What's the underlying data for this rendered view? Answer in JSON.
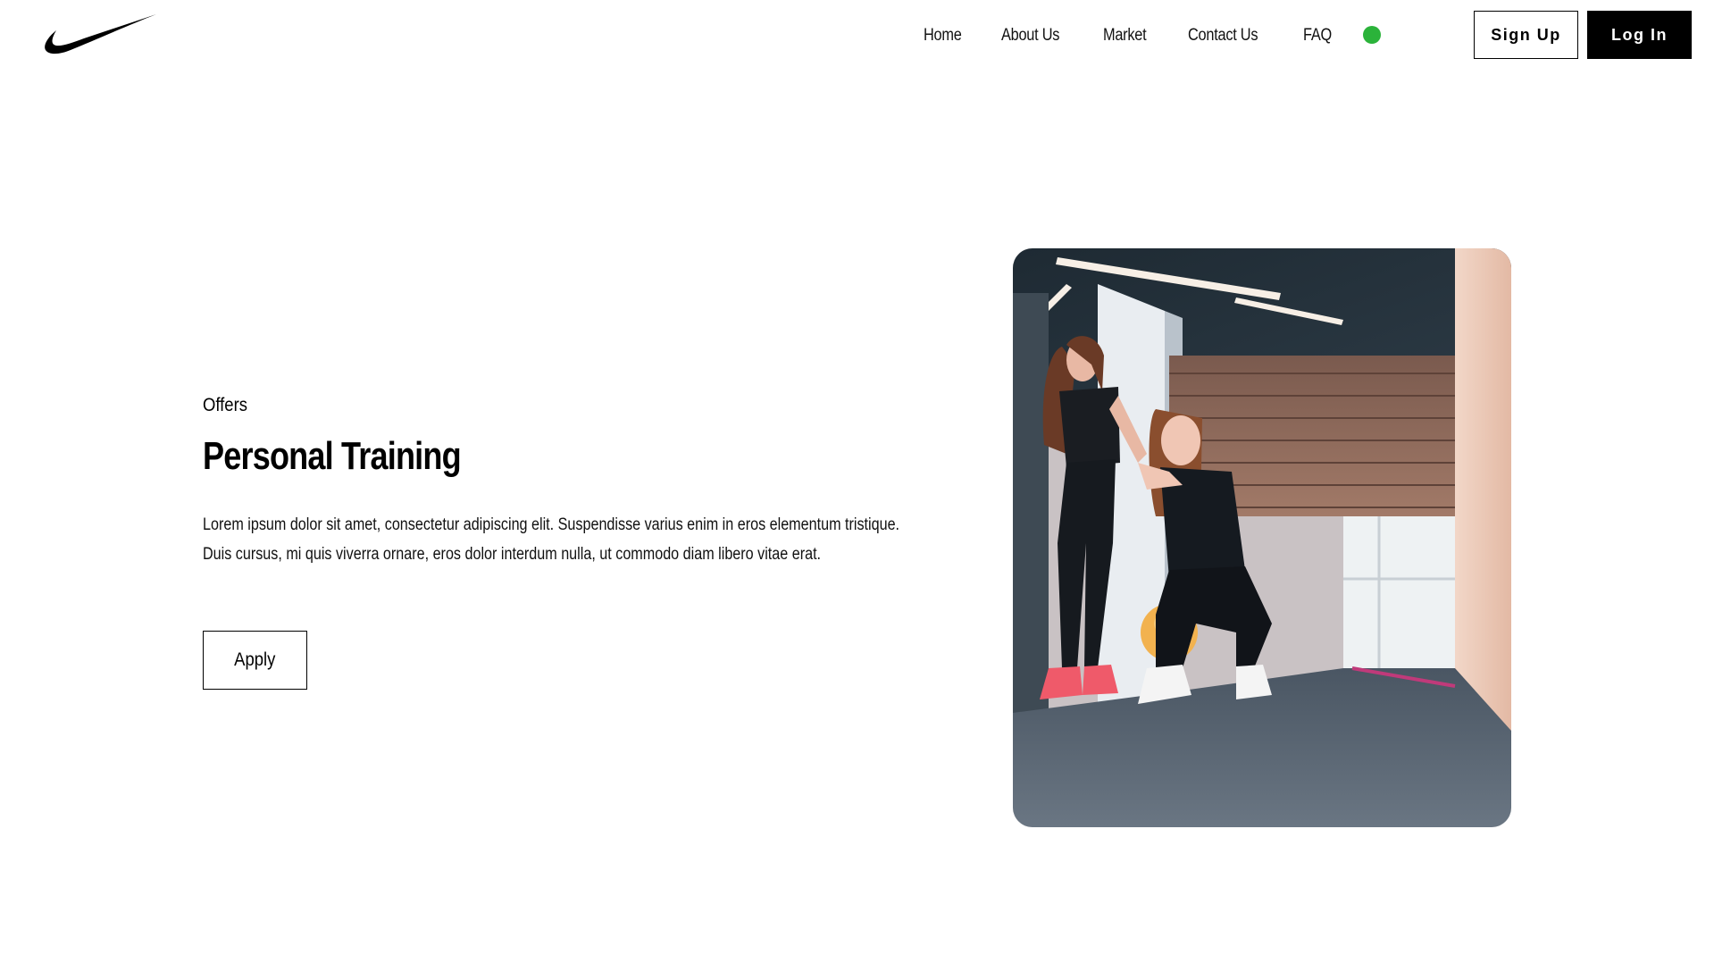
{
  "header": {
    "logo_icon": "swoosh-logo-icon",
    "nav": [
      {
        "label": "Home"
      },
      {
        "label": "About Us"
      },
      {
        "label": "Market"
      },
      {
        "label": "Contact Us"
      },
      {
        "label": "FAQ"
      }
    ],
    "status_dot_color": "#2bb33a",
    "signup_label": "Sign Up",
    "login_label": "Log In"
  },
  "hero": {
    "eyebrow": "Offers",
    "title": "Personal Training",
    "description": "Lorem ipsum dolor sit amet, consectetur adipiscing elit. Suspendisse varius enim in eros elementum tristique. Duis cursus, mi quis viverra ornare, eros dolor interdum nulla, ut commodo diam libero vitae erat.",
    "apply_label": "Apply"
  },
  "photo": {
    "icon": "personal-training-photo"
  }
}
